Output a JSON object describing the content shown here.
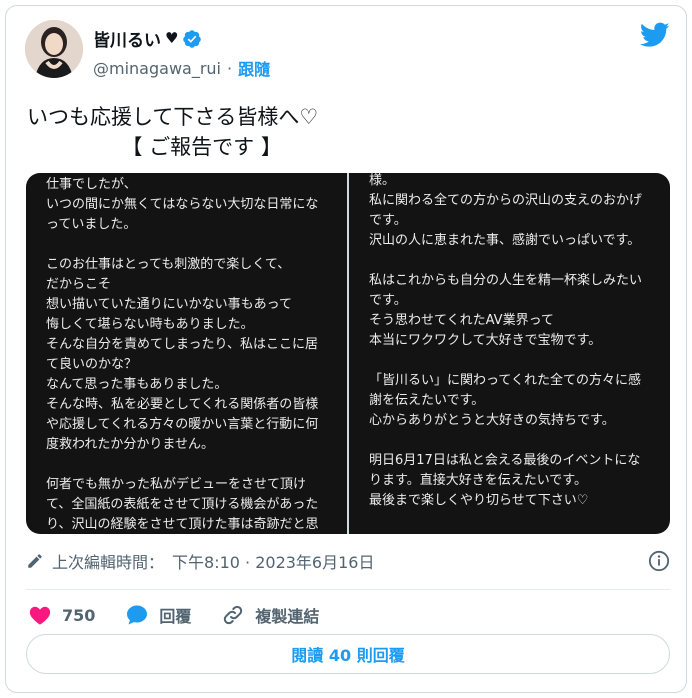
{
  "author": {
    "display_name": "皆川るい",
    "heart_glyph": "♥",
    "handle": "@minagawa_rui",
    "separator": "·",
    "follow_label": "跟隨"
  },
  "tweet": {
    "text": "いつも応援して下さる皆様へ♡\n　　　　　【 ご報告です 】"
  },
  "media": {
    "left_lines": [
      "仕事でしたが、",
      "いつの間にか無くてはならない大切な日常にな",
      "っていました。",
      "",
      "このお仕事はとっても刺激的で楽しくて、",
      "だからこそ",
      "想い描いていた通りにいかない事もあって",
      "悔しくて堪らない時もありました。",
      "そんな自分を責めてしまったり、私はここに居",
      "て良いのかな？",
      "なんて思った事もありました。",
      "そんな時、私を必要としてくれる関係者の皆様",
      "や応援してくれる方々の暖かい言葉と行動に何",
      "度救われたか分かりません。",
      "",
      "何者でも無かった私がデビューをさせて頂け",
      "て、全国紙の表紙をさせて頂ける機会があった",
      "り、沢山の経験をさせて頂けた事は奇跡だと思"
    ],
    "right_lines": [
      "様。",
      "私に関わる全ての方からの沢山の支えのおかげ",
      "です。",
      "沢山の人に恵まれた事、感謝でいっぱいです。",
      "",
      "私はこれからも自分の人生を精一杯楽しみたい",
      "です。",
      "そう思わせてくれたAV業界って",
      "本当にワクワクして大好きで宝物です。",
      "",
      "「皆川るい」に関わってくれた全ての方々に感",
      "謝を伝えたいです。",
      "心からありがとうと大好きの気持ちです。",
      "",
      "明日6月17日は私と会える最後のイベントにな",
      "ります。直接大好きを伝えたいです。",
      "最後まで楽しくやり切らせて下さい♡",
      ""
    ]
  },
  "meta": {
    "edited_label": "上次編輯時間：",
    "timestamp": "下午8:10 · 2023年6月16日"
  },
  "actions": {
    "like_count": "750",
    "reply_label": "回覆",
    "copy_link_label": "複製連結"
  },
  "read_replies_label": "閱讀 40 則回覆",
  "colors": {
    "accent": "#1d9bf0",
    "like": "#f91880",
    "text": "#0f1419",
    "secondary": "#536471",
    "media_bg": "#131313"
  },
  "icons": [
    "verified-badge-icon",
    "twitter-bird-icon",
    "pencil-icon",
    "info-icon",
    "heart-icon",
    "reply-bubble-icon",
    "link-icon"
  ]
}
